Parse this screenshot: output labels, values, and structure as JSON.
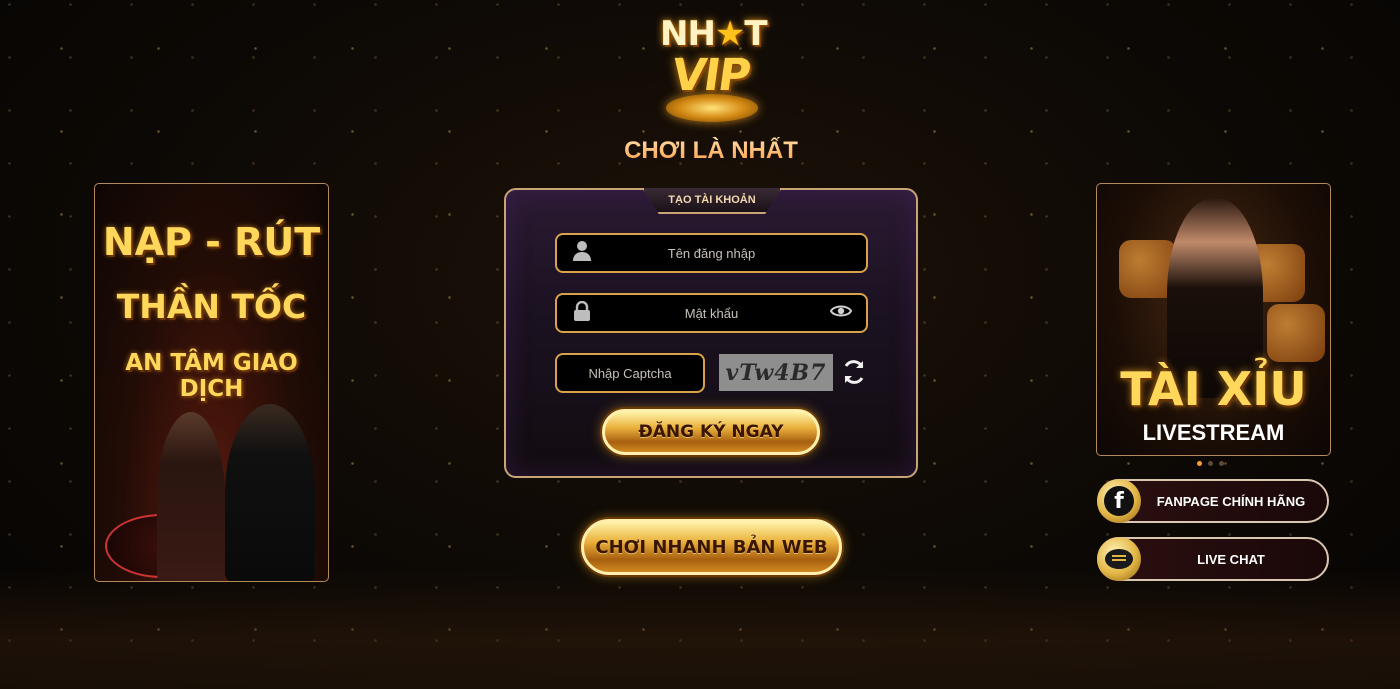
{
  "brand": {
    "logo_top": "NH",
    "logo_star": "★",
    "logo_top_end": "T",
    "logo_bottom": "VIP",
    "tagline": "CHƠI LÀ NHẤT"
  },
  "left_banner": {
    "line1": "NẠP - RÚT",
    "line2": "THẦN TỐC",
    "line3": "AN TÂM GIAO DỊCH"
  },
  "form": {
    "tab_label": "TẠO TÀI KHOẢN",
    "username_placeholder": "Tên đăng nhập",
    "password_placeholder": "Mật khẩu",
    "captcha_placeholder": "Nhập Captcha",
    "captcha_code": "vTw4B7",
    "register_label": "ĐĂNG KÝ NGAY"
  },
  "play_web_label": "CHƠI NHANH BẢN WEB",
  "right_banner": {
    "title": "TÀI XỈU",
    "subtitle": "LIVESTREAM",
    "slides": 3,
    "active_slide": 1
  },
  "side_buttons": {
    "fanpage_label": "FANPAGE CHÍNH HÃNG",
    "fanpage_icon": "facebook-icon",
    "livechat_label": "LIVE CHAT",
    "livechat_icon": "chat-bubble-icon",
    "fb_glyph": "f"
  },
  "colors": {
    "gold": "#e9b03a",
    "border": "#c9a477",
    "field_border": "#d9a24a"
  }
}
